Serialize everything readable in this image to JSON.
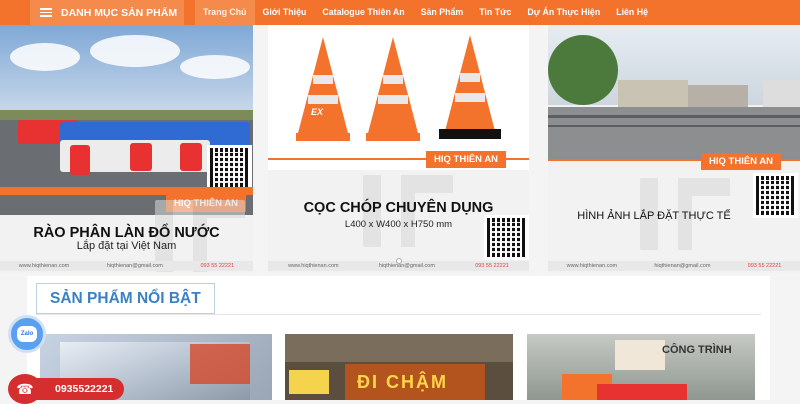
{
  "nav": {
    "category_label": "DANH MỤC SẢN PHẨM",
    "items": [
      "Trang Chủ",
      "Giới Thiệu",
      "Catalogue Thiên An",
      "Sản Phẩm",
      "Tin Tức",
      "Dự Án Thực Hiện",
      "Liên Hệ"
    ],
    "active_index": 0
  },
  "banners": [
    {
      "brand": "HIQ THIÊN AN",
      "title": "RÀO PHÂN LÀN ĐỔ NƯỚC",
      "subtitle": "Lắp đặt tại Việt Nam",
      "footer": {
        "site": "www.hiqthienan.com",
        "email": "hiqthienan@gmail.com",
        "phone": "093 55 22221"
      }
    },
    {
      "brand": "HIQ THIÊN AN",
      "title": "CỌC CHÓP CHUYÊN DỤNG",
      "subtitle": "L400 x W400 x H750 mm",
      "cone_label": "EX",
      "footer": {
        "site": "www.hiqthienan.com",
        "email": "hiqthienan@gmail.com",
        "phone": "093 55 22221"
      }
    },
    {
      "brand": "HIQ THIÊN AN",
      "title": "HÌNH ẢNH LẮP ĐẶT THỰC TẾ",
      "footer": {
        "site": "www.hiqthienan.com",
        "email": "hiqthienan@gmail.com",
        "phone": "093 55 22221"
      }
    }
  ],
  "featured": {
    "title": "SẢN PHẨM NỔI BẬT",
    "products": [
      {
        "overlay": ""
      },
      {
        "overlay": "ĐI CHẬM"
      },
      {
        "overlay": "CÔNG TRÌNH"
      }
    ]
  },
  "floating": {
    "zalo_label": "Zalo",
    "phone": "0935522221"
  },
  "colors": {
    "primary_orange": "#f3722c",
    "accent_blue": "#3a82c4",
    "call_red": "#d62e2e"
  }
}
